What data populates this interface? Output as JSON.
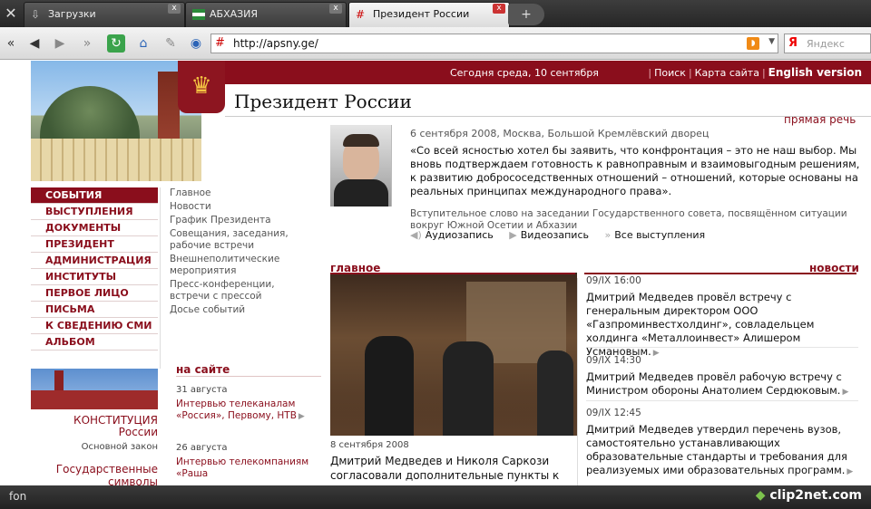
{
  "browser": {
    "tabs": [
      {
        "label": "Загрузки",
        "icon": "download-icon",
        "active": false
      },
      {
        "label": "АБХАЗИЯ",
        "icon": "flag-icon",
        "active": false
      },
      {
        "label": "Президент России",
        "icon": "site-icon",
        "active": true
      }
    ],
    "close_glyph": "x",
    "new_tab_glyph": "+",
    "address": "http://apsny.ge/",
    "search_logo": "Я",
    "search_placeholder": "Яндекс",
    "status_text": "fon",
    "brand": "clip2net.com"
  },
  "page": {
    "date_line": "Сегодня среда, 10 сентября",
    "top_links": [
      "Поиск",
      "Карта сайта"
    ],
    "english_link": "English version",
    "site_title": "Президент России",
    "speech": {
      "section_label": "прямая речь",
      "meta": "6 сентября 2008, Москва, Большой Кремлёвский дворец",
      "quote": "«Со всей ясностью хотел бы заявить, что конфронтация – это не наш выбор. Мы вновь подтверждаем готовность к равноправным и взаимовыгодным решениям, к развитию добрососедственных отношений – отношений, которые основаны на реальных принципах международного права».",
      "note": "Вступительное слово на заседании Государственного совета, посвящённом ситуации вокруг Южной Осетии и Абхазии",
      "actions": [
        "Аудиозапись",
        "Видеозапись",
        "Все выступления"
      ]
    },
    "nav": [
      "СОБЫТИЯ",
      "ВЫСТУПЛЕНИЯ",
      "ДОКУМЕНТЫ",
      "ПРЕЗИДЕНТ",
      "АДМИНИСТРАЦИЯ",
      "ИНСТИТУТЫ",
      "ПЕРВОЕ ЛИЦО",
      "ПИСЬМА",
      "К СВЕДЕНИЮ СМИ",
      "АЛЬБОМ"
    ],
    "subnav": [
      "Главное",
      "Новости",
      "График Президента",
      "Совещания, заседания, рабочие встречи",
      "Внешнеполитические мероприятия",
      "Пресс-конференции, встречи с прессой",
      "Досье событий"
    ],
    "constitution": {
      "title": "КОНСТИТУЦИЯ России",
      "subtitle": "Основной закон"
    },
    "symbols_title": "Государственные символы",
    "onsite": {
      "label": "на сайте",
      "items": [
        {
          "date": "31 августа",
          "title": "Интервью телеканалам «Россия», Первому, НТВ"
        },
        {
          "date": "26 августа",
          "title": "Интервью телекомпаниям «Раша"
        }
      ]
    },
    "main": {
      "label": "главное",
      "date": "8 сентября 2008",
      "headline": "Дмитрий Медведев и Николя Саркози согласовали дополнительные пункты к"
    },
    "news": {
      "label": "новости",
      "items": [
        {
          "date": "09/IX 16:00",
          "title": "Дмитрий Медведев провёл встречу с генеральным директором ООО «Газпроминвестхолдинг», совладельцем холдинга «Металлоинвест» Алишером Усмановым."
        },
        {
          "date": "09/IX 14:30",
          "title": "Дмитрий Медведев провёл рабочую встречу с Министром обороны Анатолием Сердюковым."
        },
        {
          "date": "09/IX 12:45",
          "title": "Дмитрий Медведев утвердил перечень вузов, самостоятельно устанавливающих образовательные стандарты и требования для реализуемых ими образовательных программ."
        }
      ]
    }
  },
  "colors": {
    "accent": "#8a0e1c",
    "chrome_dark": "#2a2a2a"
  }
}
